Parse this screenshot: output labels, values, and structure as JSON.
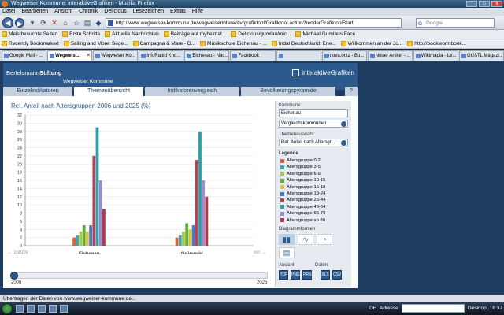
{
  "window": {
    "title": "Wegweiser Kommune: interaktiveGrafiken - Mozilla Firefox"
  },
  "menubar": [
    "Datei",
    "Bearbeiten",
    "Ansicht",
    "Chronik",
    "Delicious",
    "Lesezeichen",
    "Extras",
    "Hilfe"
  ],
  "navbar": {
    "url": "http://www.wegweiser-kommune.de/wegweiserinteraktiv/grafiktool/Grafiktool.action?renderGrafiktoolStart",
    "search_placeholder": "Google",
    "search_engine_glyph": "G"
  },
  "bookmarks_row1": [
    "Meistbesuchte Seiten",
    "Erste Schritte",
    "Aktuelle Nachrichten",
    "Beiträge auf myheimat...",
    "Delicious/gumtau/mic...",
    "Michael Gumtaus Face..."
  ],
  "bookmarks_row2": [
    "Recently Bookmarked",
    "Sailing and More: Sege...",
    "Campagna & Mare - D...",
    "Musikschule Eichenau - ...",
    "Indal Deutschland: Ene...",
    "Willkommen an der Jo...",
    "http://bookwormbook..."
  ],
  "tabs": [
    {
      "label": "Google Mail - ...",
      "active": false
    },
    {
      "label": "Wegweis...",
      "active": true
    },
    {
      "label": "Wegweiser Ko...",
      "active": false
    },
    {
      "label": "InfoRapid Kno...",
      "active": false
    },
    {
      "label": "Eichenau - Nac...",
      "active": false
    },
    {
      "label": "Facebook",
      "active": false
    },
    {
      "label": "",
      "active": false
    },
    {
      "label": "nova.or.tz - Bu...",
      "active": false
    },
    {
      "label": "Neuer Artikel - ...",
      "active": false
    },
    {
      "label": "Wikimapia - Le...",
      "active": false
    },
    {
      "label": "GUSTL Magazi...",
      "active": false
    }
  ],
  "app": {
    "brand_light": "Bertelsmann",
    "brand_bold": "Stiftung",
    "subtitle": "Wegweiser Kommune",
    "logo_text": "interaktiveGrafiken",
    "nav_tabs": [
      "Einzelindikatoren",
      "Themenübersicht",
      "Indikatorenvergleich",
      "Bevölkerungspyramide"
    ],
    "help_label": "?",
    "active_tab": "Themenübersicht"
  },
  "chart_data": {
    "type": "bar",
    "title": "Rel. Anteil nach Altersgruppen 2006 und 2025 (%)",
    "ylim": [
      0,
      32
    ],
    "yticks": [
      0,
      2,
      4,
      6,
      8,
      10,
      12,
      14,
      16,
      18,
      20,
      22,
      24,
      26,
      28,
      30,
      32
    ],
    "categories": [
      "Eichenau",
      "Grünwald"
    ],
    "grid": true,
    "series": [
      {
        "name": "Altersgruppe 0-2",
        "color": "#d9663a",
        "values": [
          2,
          2
        ]
      },
      {
        "name": "Altersgruppe 3-5",
        "color": "#3ba7b5",
        "values": [
          2.5,
          2.5
        ]
      },
      {
        "name": "Altersgruppe 6-9",
        "color": "#a5c84a",
        "values": [
          3.5,
          3.5
        ]
      },
      {
        "name": "Altersgruppe 10-15",
        "color": "#5fae3a",
        "values": [
          5,
          5.5
        ]
      },
      {
        "name": "Altersgruppe 16-18",
        "color": "#d8c63a",
        "values": [
          3.5,
          4
        ]
      },
      {
        "name": "Altersgruppe 19-24",
        "color": "#4d78c4",
        "values": [
          5,
          5
        ]
      },
      {
        "name": "Altersgruppe 25-44",
        "color": "#b0465e",
        "values": [
          22,
          21
        ]
      },
      {
        "name": "Altersgruppe 45-64",
        "color": "#2fa0a5",
        "values": [
          29,
          28
        ]
      },
      {
        "name": "Altersgruppe 65-79",
        "color": "#a28cd0",
        "values": [
          16,
          16
        ]
      },
      {
        "name": "Altersgruppe ab 80",
        "color": "#b03a4c",
        "values": [
          9,
          12
        ]
      }
    ]
  },
  "pager": {
    "prev": "← zurück",
    "next": "vor →"
  },
  "timeline": {
    "start": "2006",
    "end": "2025",
    "progress": 0
  },
  "sidepanel": {
    "kommune_label": "Kommune:",
    "kommune_value": "Eichenau",
    "vergleich_value": "Vergleichskommunen",
    "thema_label": "Themenauswahl:",
    "thema_value": "Rel. Anteil nach Altersgr...",
    "legende_label": "Legende",
    "diagramm_label": "Diagrammformen",
    "ansicht_label": "Ansicht",
    "daten_label": "Daten",
    "diagram_types": [
      "bar",
      "line",
      "pie",
      "table"
    ],
    "export_buttons": [
      "PDF",
      "PNG",
      "PRN",
      "XLS",
      "CSV"
    ]
  },
  "statusbar": {
    "text": "Übertragen der Daten von www.wegweiser-kommune.de..."
  },
  "taskbar": {
    "lang": "DE",
    "address_label": "Adresse",
    "desktop_label": "Desktop",
    "time": "18:37"
  }
}
